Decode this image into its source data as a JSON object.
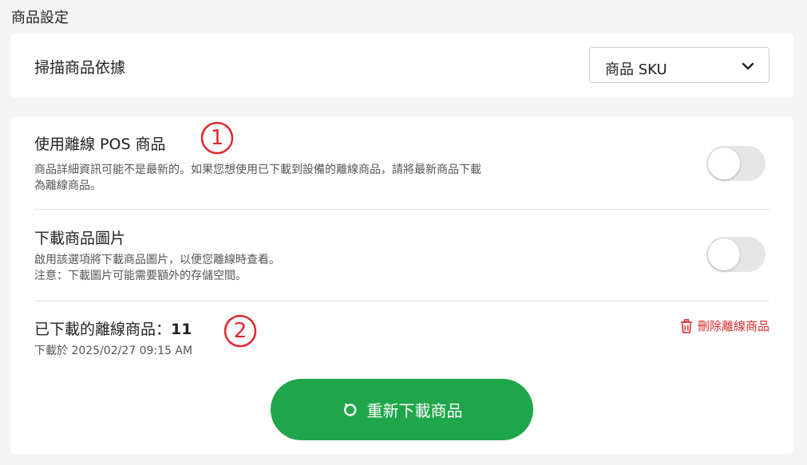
{
  "section_title": "商品設定",
  "scan": {
    "label": "掃描商品依據",
    "selected": "商品 SKU",
    "caret_icon": "chevron-down-icon"
  },
  "offline_pos": {
    "title": "使用離線 POS 商品",
    "desc_line1": "商品詳細資訊可能不是最新的。如果您想使用已下載到設備的離線商品，請將最新商品下載",
    "desc_line2": "為離線商品。",
    "enabled": false
  },
  "download_images": {
    "title": "下載商品圖片",
    "desc_line1": "啟用該選項將下載商品圖片，以便您離線時查看。",
    "desc_line2": "注意：下載圖片可能需要額外的存儲空間。",
    "enabled": false
  },
  "downloaded": {
    "label": "已下載的離線商品：",
    "count": "11",
    "timestamp": "下載於 2025/02/27 09:15 AM",
    "delete_label": "刪除離線商品",
    "delete_icon": "trash-icon"
  },
  "redownload_button": {
    "label": "重新下載商品",
    "icon": "refresh-icon"
  },
  "annotations": [
    "1",
    "2"
  ],
  "colors": {
    "primary": "#1fa64a",
    "danger": "#d92b2b",
    "annotation": "#e0282e",
    "toggle_off": "#e6e6e6"
  }
}
